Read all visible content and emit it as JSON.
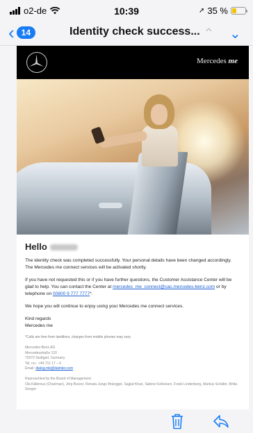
{
  "status_bar": {
    "carrier": "o2-de",
    "time": "10:39",
    "battery": "35 %",
    "battery_level": 0.35
  },
  "nav": {
    "back_count": "14",
    "title": "Identity check success..."
  },
  "email": {
    "brand": {
      "name": "Mercedes",
      "suffix": "me"
    },
    "greeting": "Hello",
    "p1": "The identity check was completed successfully. Your personal details have been changed accordingly. The Mercedes me connect services will be activated shortly.",
    "p2_a": "If you have not requested this or if you have further questions, the Customer Assistance Center will be glad to help. You can contact the Center at ",
    "p2_link": "mercedes_me_connect@cac.mercedes-benz.com",
    "p2_b": " or by telephone on ",
    "p2_phone": "00800 9 777 7777",
    "p2_c": "*.",
    "p3": "We hope you will continue to enjoy using your Mercedes me connect services.",
    "regards": "Kind regards",
    "signature": "Mercedes me",
    "footnote": "*Calls are free from landlines, charges from mobile phones may vary.",
    "company": "Mercedes-Benz AG",
    "street": "Mercedesstraße 120",
    "city": "70372 Stuttgart, Germany",
    "tel": "Tel. no.: +49 711 17 – 0",
    "email_label": "Email: ",
    "email_link": "dialog.mb@daimler.com",
    "board_label": "Represented by the Board of Management:",
    "board": "Ola Källenius (Chairman), Jörg Burzer, Renata Jungo Brüngger, Sajjad Khan, Sabine Kohleisen, Frank Lindenberg, Markus Schäfer, Britta Seeger"
  }
}
